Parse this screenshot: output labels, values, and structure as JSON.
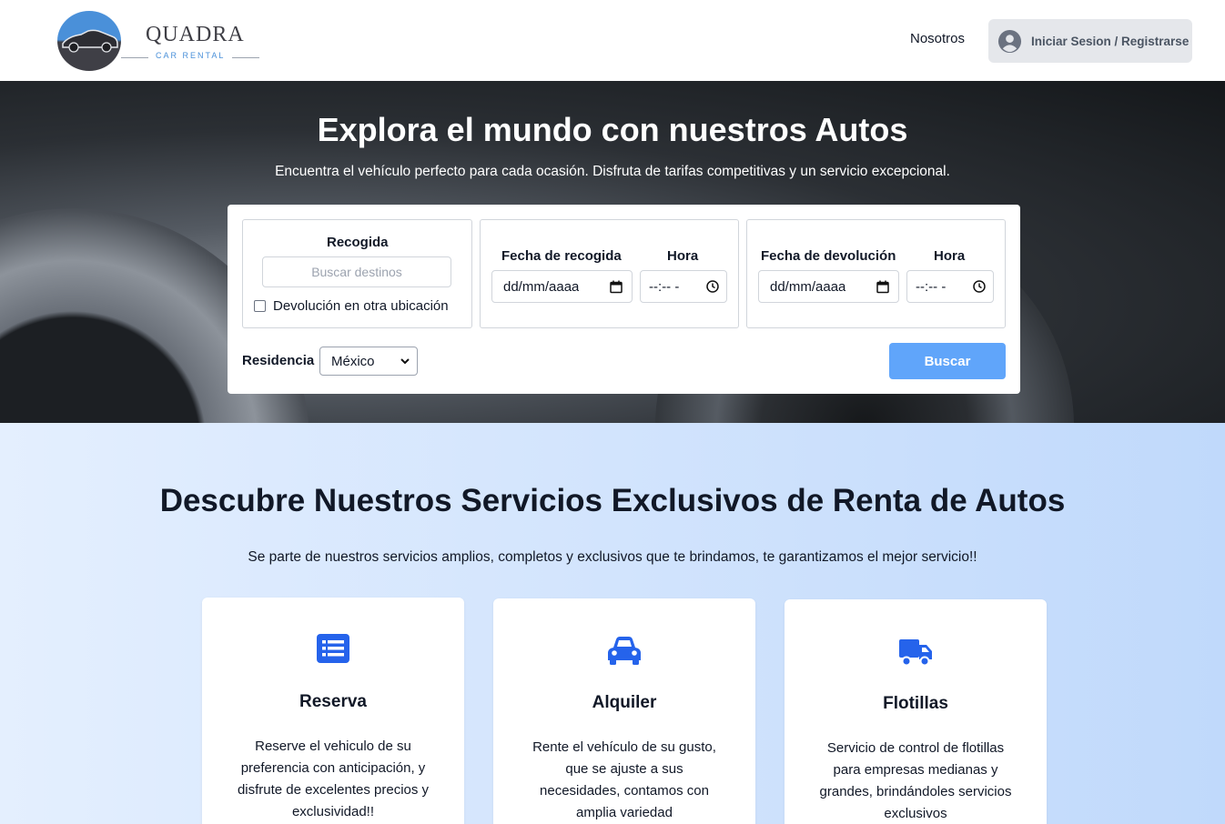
{
  "header": {
    "logo_title": "QUADRA",
    "logo_subtitle": "CAR RENTAL",
    "nav_link": "Nosotros",
    "login_label": "Iniciar Sesion / Registrarse"
  },
  "hero": {
    "title": "Explora el mundo con nuestros Autos",
    "subtitle": "Encuentra el vehículo perfecto para cada ocasión. Disfruta de tarifas competitivas y un servicio excepcional."
  },
  "search": {
    "pickup_label": "Recogida",
    "pickup_placeholder": "Buscar destinos",
    "return_other_label": "Devolución en otra ubicación",
    "pickup_date_label": "Fecha de recogida",
    "pickup_time_label": "Hora",
    "return_date_label": "Fecha de devolución",
    "return_time_label": "Hora",
    "date_placeholder": "dd/mm/aaaa",
    "time_placeholder": "--:-- -",
    "residence_label": "Residencia",
    "residence_value": "México",
    "search_button": "Buscar"
  },
  "services": {
    "title": "Descubre Nuestros Servicios Exclusivos de Renta de Autos",
    "subtitle": "Se parte de nuestros servicios amplios, completos y exclusivos que te brindamos, te garantizamos el mejor servicio!!",
    "cards": [
      {
        "icon": "list-icon",
        "title": "Reserva",
        "text": "Reserve el vehiculo de su preferencia con anticipación, y disfrute de excelentes precios y exclusividad!!"
      },
      {
        "icon": "car-icon",
        "title": "Alquiler",
        "text": "Rente el vehículo de su gusto, que se ajuste a sus necesidades, contamos con amplia variedad"
      },
      {
        "icon": "truck-icon",
        "title": "Flotillas",
        "text": "Servicio de control de flotillas para empresas medianas y grandes, brindándoles servicios exclusivos"
      }
    ]
  },
  "colors": {
    "accent": "#2563eb",
    "button_light": "#60a5fa",
    "logo_blue": "#4a90d9"
  }
}
